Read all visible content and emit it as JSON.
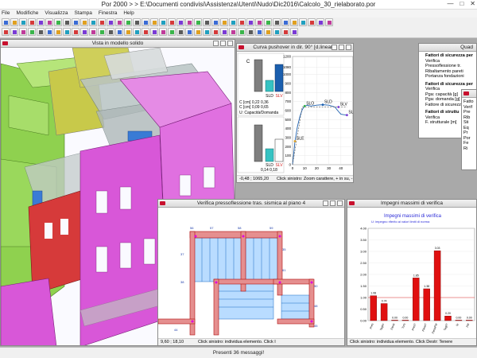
{
  "app": {
    "title": "Por 2000 > > E:\\Documenti condivisi\\Assistenza\\Utenti\\Nudo\\Dic2016\\Calcolo_30_rielaborato.por",
    "controls": [
      "—",
      "□",
      "✕"
    ]
  },
  "menu": [
    "File",
    "Modifiche",
    "Visualizza",
    "Stampa",
    "Finestra",
    "Help"
  ],
  "statusbar": {
    "message": "Presenti 36 messaggi!"
  },
  "win3d": {
    "title": "Vista in modello solido"
  },
  "pushover": {
    "title": "Curva pushover in dir. 90° [d.lineare]",
    "upper": {
      "header": "C [cm]   0,22   0,36",
      "row2": "C [cm]   0,09   0,65",
      "label1": "SLD",
      "label2": "SLV",
      "capacity_label": "U: Capacità/Domanda",
      "c_label": "C"
    },
    "lower": {
      "label1": "SLD",
      "label2": "SLV",
      "row1": "0,14   0,18",
      "row2": "0,13   0,58"
    },
    "foot_coord": "-0,48 ; 1065,20",
    "foot_hint": "Click sinistro: Zoom carattere, + in su, - in giù. Cli",
    "chart_points": [
      "SLE",
      "SLO",
      "SLD",
      "SLV",
      "SLC"
    ]
  },
  "chart_data": [
    {
      "type": "line",
      "title": "Curva pushover in dir. 90° [d.lineare]",
      "xlabel": "",
      "ylabel": "",
      "ylim": [
        0,
        1200
      ],
      "xlim": [
        0,
        50
      ],
      "yticks": [
        0,
        100,
        200,
        300,
        400,
        500,
        600,
        700,
        800,
        900,
        1000,
        1080,
        1200
      ],
      "xticks": [
        0,
        10,
        20,
        30,
        40
      ],
      "series": [
        {
          "name": "",
          "x": [
            0,
            2,
            4,
            6,
            8,
            10,
            12,
            15,
            20,
            25,
            30,
            35,
            38,
            40,
            42,
            45
          ],
          "y": [
            0,
            260,
            420,
            530,
            610,
            650,
            660,
            650,
            660,
            665,
            660,
            640,
            590,
            560,
            555,
            550
          ]
        }
      ],
      "annotations": [
        {
          "label": "SLE",
          "x": 2,
          "y": 260
        },
        {
          "label": "SLO",
          "x": 10,
          "y": 650
        },
        {
          "label": "SLD",
          "x": 25,
          "y": 665
        },
        {
          "label": "SLV",
          "x": 38,
          "y": 640
        },
        {
          "label": "SLC",
          "x": 45,
          "y": 550
        }
      ]
    },
    {
      "type": "bar",
      "title": "Impegni massimi di verifica",
      "subtitle": "U: impegno riferito ai valori limiti di norma",
      "categories": [
        "Pres",
        "Taglio",
        "Fless",
        "Tors",
        "PresT",
        "FlessT",
        "FlessFM",
        "TagliT",
        "Sr",
        "FM"
      ],
      "values": [
        1.08,
        0.74,
        0.0,
        0.0,
        1.85,
        1.38,
        3.03,
        0.2,
        0.0,
        0.0
      ],
      "ylim": [
        0,
        4
      ],
      "yticks": [
        0,
        0.5,
        1,
        1.5,
        2,
        2.5,
        3,
        3.5,
        4
      ]
    }
  ],
  "verifica": {
    "title": "Verifica pressoflessione tras. sismica al piano 4",
    "foot_coord": "9,60 ; 18,10",
    "foot_hint": "Click sinistro: individua elemento. Click I"
  },
  "impegni": {
    "title": "Impegni massimi di verifica",
    "chart_title": "Impegni massimi di verifica",
    "foot_hint": "Click sinistro: individua elemento. Click Destr: Tenere"
  },
  "quad": {
    "title": "Quad",
    "block1": [
      "Fattori di sicurezza per",
      "Verifica",
      "Pressoflessione tr.",
      "Ribaltamento pareti",
      "Portanza fondazioni"
    ],
    "block2": [
      "Fattori di sicurezza per",
      "Verifica",
      "Pga: capacità [g]",
      "Pga: domanda [g]",
      "Fattore di sicurezza"
    ],
    "block3": [
      "Fattori di struttu",
      "Verifica",
      "F. strutturale [m]"
    ]
  },
  "fatto": {
    "title": "Fatto",
    "list": [
      "Fatto",
      "Verif",
      "Pre",
      "Rib",
      "Sti",
      "Eq",
      "Pr",
      "Por",
      "Fe",
      "Ri"
    ]
  }
}
